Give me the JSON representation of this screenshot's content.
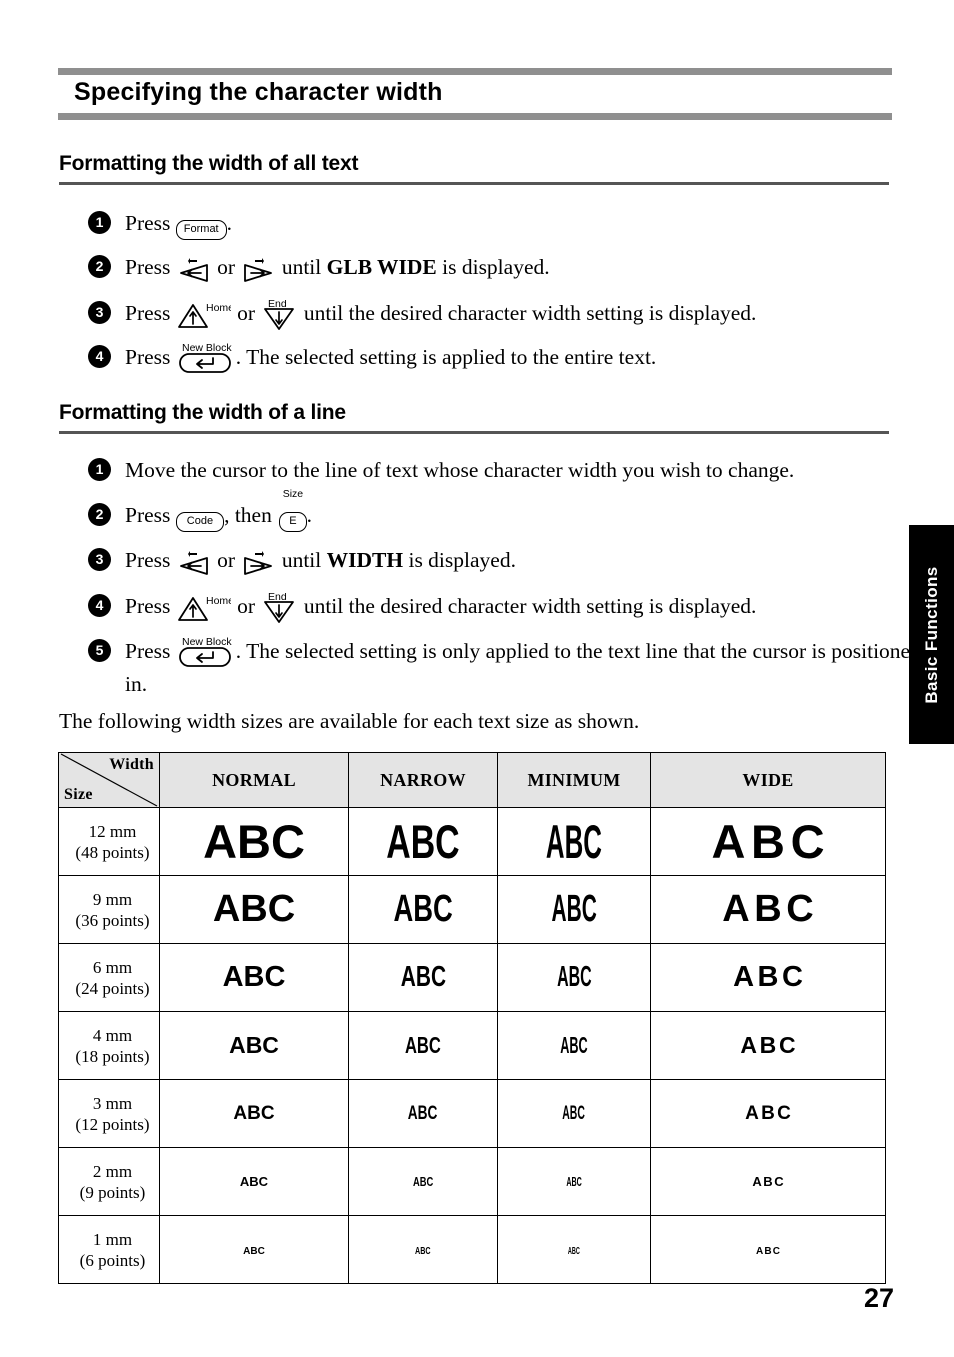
{
  "chapter": {
    "title": "Specifying the character width"
  },
  "side_tab": {
    "label": "Basic Functions"
  },
  "page_number": "27",
  "sections": [
    {
      "heading": "Formatting the width of all text",
      "steps": [
        {
          "number": "1",
          "pre": "Press ",
          "keys": [
            {
              "type": "keycap",
              "label": "Format"
            }
          ],
          "post": "."
        },
        {
          "number": "2",
          "pre": "Press ",
          "keys": [
            {
              "type": "arrow-left",
              "label": "left-arrow-key"
            },
            {
              "type": "arrow-right",
              "label": "right-arrow-key"
            }
          ],
          "joiner": " or ",
          "post_a": " until ",
          "bold": "GLB WIDE",
          "post_b": " is displayed."
        },
        {
          "number": "3",
          "pre": "Press ",
          "keys": [
            {
              "type": "arrow-up",
              "sup": "Home"
            },
            {
              "type": "arrow-down",
              "sup": "End"
            }
          ],
          "joiner": " or ",
          "post": " until the desired character width setting is displayed."
        },
        {
          "number": "4",
          "pre": "Press ",
          "keys": [
            {
              "type": "keycap-enter",
              "sup": "New Block"
            }
          ],
          "post": ". The selected setting is applied to the entire text."
        }
      ]
    },
    {
      "heading": "Formatting the width of a line",
      "steps": [
        {
          "number": "1",
          "text": "Move the cursor to the line of text whose character width you wish to change."
        },
        {
          "number": "2",
          "pre": "Press ",
          "keys": [
            {
              "type": "keycap",
              "label": "Code"
            },
            {
              "type": "keycap-letter",
              "label": "E",
              "sup": "Size"
            }
          ],
          "joiner": ", then ",
          "post": "."
        },
        {
          "number": "3",
          "pre": "Press ",
          "keys": [
            {
              "type": "arrow-left",
              "label": "left-arrow-key"
            },
            {
              "type": "arrow-right",
              "label": "right-arrow-key"
            }
          ],
          "joiner": " or ",
          "post_a": " until ",
          "bold": "WIDTH",
          "post_b": " is displayed."
        },
        {
          "number": "4",
          "pre": "Press ",
          "keys": [
            {
              "type": "arrow-up",
              "sup": "Home"
            },
            {
              "type": "arrow-down",
              "sup": "End"
            }
          ],
          "joiner": " or ",
          "post": " until the desired character width setting is displayed."
        },
        {
          "number": "5",
          "pre": "Press ",
          "keys": [
            {
              "type": "keycap-enter",
              "sup": "New Block"
            }
          ],
          "post": ". The selected setting is only applied to the text line that the cursor is positioned in."
        }
      ]
    }
  ],
  "note": "The following width sizes are available for each text size as shown.",
  "table": {
    "corner": {
      "width_label": "Width",
      "size_label": "Size"
    },
    "columns": [
      "NORMAL",
      "NARROW",
      "MINIMUM",
      "WIDE"
    ],
    "sample_text": "ABC",
    "rows": [
      {
        "size": "12 mm",
        "points": "(48 points)",
        "font_px": 47
      },
      {
        "size": "9 mm",
        "points": "(36 points)",
        "font_px": 38
      },
      {
        "size": "6 mm",
        "points": "(24 points)",
        "font_px": 29
      },
      {
        "size": "4 mm",
        "points": "(18 points)",
        "font_px": 23
      },
      {
        "size": "3 mm",
        "points": "(12 points)",
        "font_px": 19
      },
      {
        "size": "2 mm",
        "points": "(9 points)",
        "font_px": 13
      },
      {
        "size": "1 mm",
        "points": "(6 points)",
        "font_px": 10
      }
    ]
  },
  "colors": {
    "rule_gray": "#8f8f8f",
    "section_rule": "#555555",
    "table_header_bg": "#e4e4e4",
    "side_tab_bg": "#000000"
  }
}
